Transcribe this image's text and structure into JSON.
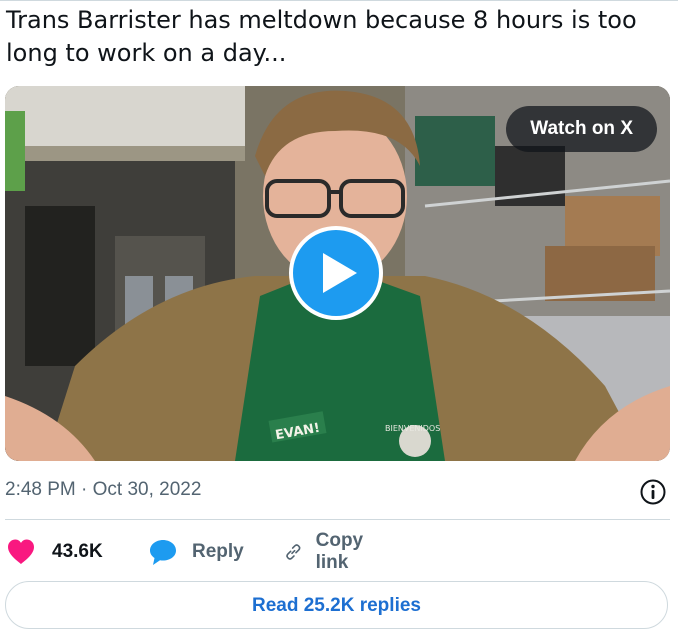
{
  "tweet": {
    "text": "Trans Barrister has meltdown because 8 hours is too long to work on a day...",
    "timestamp": "2:48 PM · Oct 30, 2022"
  },
  "media": {
    "watch_label": "Watch on X",
    "apron_name_tag": "EVAN!",
    "apron_badge": "BIENVENIDOS"
  },
  "actions": {
    "like_count": "43.6K",
    "reply_label": "Reply",
    "copy_link_label": "Copy link"
  },
  "read_replies_label": "Read 25.2K replies",
  "colors": {
    "like": "#f91880",
    "reply": "#1d9bf0",
    "play": "#1d9bf0",
    "link_text": "#1d6fd1"
  }
}
